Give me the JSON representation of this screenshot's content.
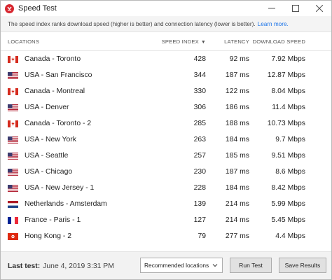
{
  "window": {
    "title": "Speed Test",
    "app_icon": "expressvpn-logo-icon",
    "controls": [
      "minimize-icon",
      "maximize-icon",
      "close-icon"
    ]
  },
  "info": {
    "text": "The speed index ranks download speed (higher is better) and connection latency (lower is better).",
    "link": "Learn more."
  },
  "table": {
    "headers": {
      "location": "LOCATIONS",
      "speed_index": "SPEED INDEX",
      "latency": "LATENCY",
      "download": "DOWNLOAD SPEED"
    },
    "sort_indicator": "▼",
    "rows": [
      {
        "flag": "canada",
        "location": "Canada - Toronto",
        "speed_index": "428",
        "latency": "92 ms",
        "download": "7.92 Mbps"
      },
      {
        "flag": "usa",
        "location": "USA - San Francisco",
        "speed_index": "344",
        "latency": "187 ms",
        "download": "12.87 Mbps"
      },
      {
        "flag": "canada",
        "location": "Canada - Montreal",
        "speed_index": "330",
        "latency": "122 ms",
        "download": "8.04 Mbps"
      },
      {
        "flag": "usa",
        "location": "USA - Denver",
        "speed_index": "306",
        "latency": "186 ms",
        "download": "11.4 Mbps"
      },
      {
        "flag": "canada",
        "location": "Canada - Toronto - 2",
        "speed_index": "285",
        "latency": "188 ms",
        "download": "10.73 Mbps"
      },
      {
        "flag": "usa",
        "location": "USA - New York",
        "speed_index": "263",
        "latency": "184 ms",
        "download": "9.7 Mbps"
      },
      {
        "flag": "usa",
        "location": "USA - Seattle",
        "speed_index": "257",
        "latency": "185 ms",
        "download": "9.51 Mbps"
      },
      {
        "flag": "usa",
        "location": "USA - Chicago",
        "speed_index": "230",
        "latency": "187 ms",
        "download": "8.6 Mbps"
      },
      {
        "flag": "usa",
        "location": "USA - New Jersey - 1",
        "speed_index": "228",
        "latency": "184 ms",
        "download": "8.42 Mbps"
      },
      {
        "flag": "netherlands",
        "location": "Netherlands - Amsterdam",
        "speed_index": "139",
        "latency": "214 ms",
        "download": "5.99 Mbps"
      },
      {
        "flag": "france",
        "location": "France - Paris - 1",
        "speed_index": "127",
        "latency": "214 ms",
        "download": "5.45 Mbps"
      },
      {
        "flag": "hongkong",
        "location": "Hong Kong - 2",
        "speed_index": "79",
        "latency": "277 ms",
        "download": "4.4 Mbps"
      }
    ]
  },
  "footer": {
    "last_test_label": "Last test:",
    "last_test_value": "June 4, 2019 3:31 PM",
    "filter_selected": "Recommended locations",
    "run_button": "Run Test",
    "save_button": "Save Results"
  },
  "colors": {
    "accent": "#d7262f",
    "link": "#1a73e8",
    "footer_bg": "#f2f2f2",
    "info_bg": "#f4f4f4"
  }
}
